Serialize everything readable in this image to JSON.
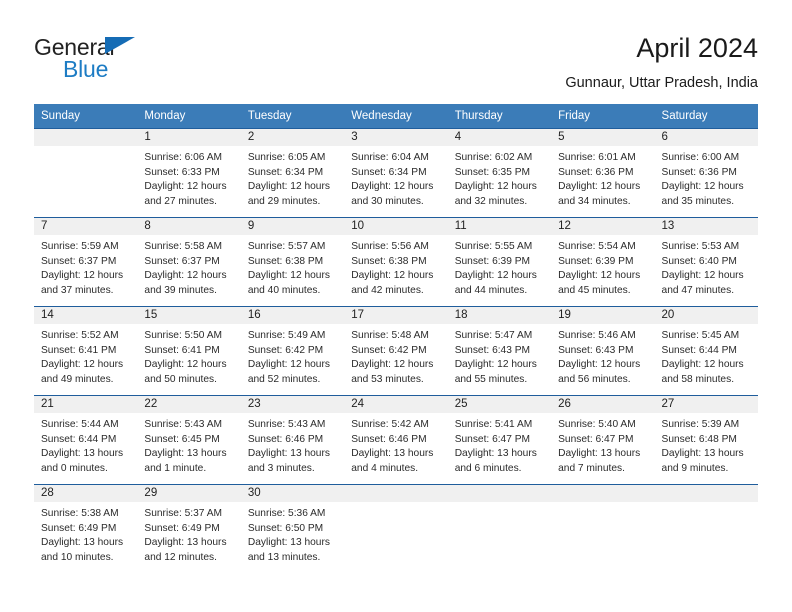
{
  "brand": {
    "name_part1": "General",
    "name_part2": "Blue",
    "logo_icon": "triangle-flag-icon",
    "color_blue": "#1d7cc4"
  },
  "header": {
    "title": "April 2024",
    "subtitle": "Gunnaur, Uttar Pradesh, India"
  },
  "colors": {
    "header_row_bg": "#3b7cb8",
    "week_divider": "#1f5d9c",
    "daynum_band_bg": "#f0f0f0"
  },
  "weekdays": [
    "Sunday",
    "Monday",
    "Tuesday",
    "Wednesday",
    "Thursday",
    "Friday",
    "Saturday"
  ],
  "weeks": [
    [
      {
        "day": "",
        "empty": true
      },
      {
        "day": "1",
        "sunrise": "Sunrise: 6:06 AM",
        "sunset": "Sunset: 6:33 PM",
        "daylight_line1": "Daylight: 12 hours",
        "daylight_line2": "and 27 minutes."
      },
      {
        "day": "2",
        "sunrise": "Sunrise: 6:05 AM",
        "sunset": "Sunset: 6:34 PM",
        "daylight_line1": "Daylight: 12 hours",
        "daylight_line2": "and 29 minutes."
      },
      {
        "day": "3",
        "sunrise": "Sunrise: 6:04 AM",
        "sunset": "Sunset: 6:34 PM",
        "daylight_line1": "Daylight: 12 hours",
        "daylight_line2": "and 30 minutes."
      },
      {
        "day": "4",
        "sunrise": "Sunrise: 6:02 AM",
        "sunset": "Sunset: 6:35 PM",
        "daylight_line1": "Daylight: 12 hours",
        "daylight_line2": "and 32 minutes."
      },
      {
        "day": "5",
        "sunrise": "Sunrise: 6:01 AM",
        "sunset": "Sunset: 6:36 PM",
        "daylight_line1": "Daylight: 12 hours",
        "daylight_line2": "and 34 minutes."
      },
      {
        "day": "6",
        "sunrise": "Sunrise: 6:00 AM",
        "sunset": "Sunset: 6:36 PM",
        "daylight_line1": "Daylight: 12 hours",
        "daylight_line2": "and 35 minutes."
      }
    ],
    [
      {
        "day": "7",
        "sunrise": "Sunrise: 5:59 AM",
        "sunset": "Sunset: 6:37 PM",
        "daylight_line1": "Daylight: 12 hours",
        "daylight_line2": "and 37 minutes."
      },
      {
        "day": "8",
        "sunrise": "Sunrise: 5:58 AM",
        "sunset": "Sunset: 6:37 PM",
        "daylight_line1": "Daylight: 12 hours",
        "daylight_line2": "and 39 minutes."
      },
      {
        "day": "9",
        "sunrise": "Sunrise: 5:57 AM",
        "sunset": "Sunset: 6:38 PM",
        "daylight_line1": "Daylight: 12 hours",
        "daylight_line2": "and 40 minutes."
      },
      {
        "day": "10",
        "sunrise": "Sunrise: 5:56 AM",
        "sunset": "Sunset: 6:38 PM",
        "daylight_line1": "Daylight: 12 hours",
        "daylight_line2": "and 42 minutes."
      },
      {
        "day": "11",
        "sunrise": "Sunrise: 5:55 AM",
        "sunset": "Sunset: 6:39 PM",
        "daylight_line1": "Daylight: 12 hours",
        "daylight_line2": "and 44 minutes."
      },
      {
        "day": "12",
        "sunrise": "Sunrise: 5:54 AM",
        "sunset": "Sunset: 6:39 PM",
        "daylight_line1": "Daylight: 12 hours",
        "daylight_line2": "and 45 minutes."
      },
      {
        "day": "13",
        "sunrise": "Sunrise: 5:53 AM",
        "sunset": "Sunset: 6:40 PM",
        "daylight_line1": "Daylight: 12 hours",
        "daylight_line2": "and 47 minutes."
      }
    ],
    [
      {
        "day": "14",
        "sunrise": "Sunrise: 5:52 AM",
        "sunset": "Sunset: 6:41 PM",
        "daylight_line1": "Daylight: 12 hours",
        "daylight_line2": "and 49 minutes."
      },
      {
        "day": "15",
        "sunrise": "Sunrise: 5:50 AM",
        "sunset": "Sunset: 6:41 PM",
        "daylight_line1": "Daylight: 12 hours",
        "daylight_line2": "and 50 minutes."
      },
      {
        "day": "16",
        "sunrise": "Sunrise: 5:49 AM",
        "sunset": "Sunset: 6:42 PM",
        "daylight_line1": "Daylight: 12 hours",
        "daylight_line2": "and 52 minutes."
      },
      {
        "day": "17",
        "sunrise": "Sunrise: 5:48 AM",
        "sunset": "Sunset: 6:42 PM",
        "daylight_line1": "Daylight: 12 hours",
        "daylight_line2": "and 53 minutes."
      },
      {
        "day": "18",
        "sunrise": "Sunrise: 5:47 AM",
        "sunset": "Sunset: 6:43 PM",
        "daylight_line1": "Daylight: 12 hours",
        "daylight_line2": "and 55 minutes."
      },
      {
        "day": "19",
        "sunrise": "Sunrise: 5:46 AM",
        "sunset": "Sunset: 6:43 PM",
        "daylight_line1": "Daylight: 12 hours",
        "daylight_line2": "and 56 minutes."
      },
      {
        "day": "20",
        "sunrise": "Sunrise: 5:45 AM",
        "sunset": "Sunset: 6:44 PM",
        "daylight_line1": "Daylight: 12 hours",
        "daylight_line2": "and 58 minutes."
      }
    ],
    [
      {
        "day": "21",
        "sunrise": "Sunrise: 5:44 AM",
        "sunset": "Sunset: 6:44 PM",
        "daylight_line1": "Daylight: 13 hours",
        "daylight_line2": "and 0 minutes."
      },
      {
        "day": "22",
        "sunrise": "Sunrise: 5:43 AM",
        "sunset": "Sunset: 6:45 PM",
        "daylight_line1": "Daylight: 13 hours",
        "daylight_line2": "and 1 minute."
      },
      {
        "day": "23",
        "sunrise": "Sunrise: 5:43 AM",
        "sunset": "Sunset: 6:46 PM",
        "daylight_line1": "Daylight: 13 hours",
        "daylight_line2": "and 3 minutes."
      },
      {
        "day": "24",
        "sunrise": "Sunrise: 5:42 AM",
        "sunset": "Sunset: 6:46 PM",
        "daylight_line1": "Daylight: 13 hours",
        "daylight_line2": "and 4 minutes."
      },
      {
        "day": "25",
        "sunrise": "Sunrise: 5:41 AM",
        "sunset": "Sunset: 6:47 PM",
        "daylight_line1": "Daylight: 13 hours",
        "daylight_line2": "and 6 minutes."
      },
      {
        "day": "26",
        "sunrise": "Sunrise: 5:40 AM",
        "sunset": "Sunset: 6:47 PM",
        "daylight_line1": "Daylight: 13 hours",
        "daylight_line2": "and 7 minutes."
      },
      {
        "day": "27",
        "sunrise": "Sunrise: 5:39 AM",
        "sunset": "Sunset: 6:48 PM",
        "daylight_line1": "Daylight: 13 hours",
        "daylight_line2": "and 9 minutes."
      }
    ],
    [
      {
        "day": "28",
        "sunrise": "Sunrise: 5:38 AM",
        "sunset": "Sunset: 6:49 PM",
        "daylight_line1": "Daylight: 13 hours",
        "daylight_line2": "and 10 minutes."
      },
      {
        "day": "29",
        "sunrise": "Sunrise: 5:37 AM",
        "sunset": "Sunset: 6:49 PM",
        "daylight_line1": "Daylight: 13 hours",
        "daylight_line2": "and 12 minutes."
      },
      {
        "day": "30",
        "sunrise": "Sunrise: 5:36 AM",
        "sunset": "Sunset: 6:50 PM",
        "daylight_line1": "Daylight: 13 hours",
        "daylight_line2": "and 13 minutes."
      },
      {
        "day": "",
        "empty": true
      },
      {
        "day": "",
        "empty": true
      },
      {
        "day": "",
        "empty": true
      },
      {
        "day": "",
        "empty": true
      }
    ]
  ]
}
